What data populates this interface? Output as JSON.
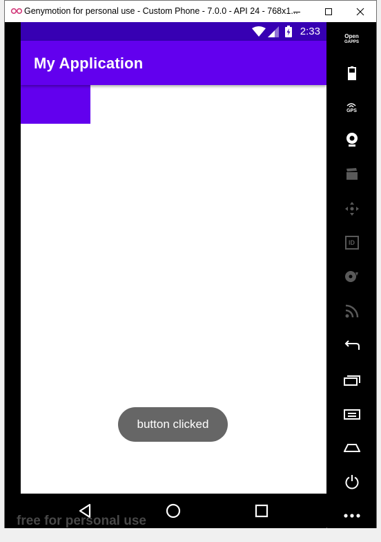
{
  "window": {
    "title": "Genymotion for personal use - Custom Phone - 7.0.0 - API 24 - 768x1...",
    "minimize_icon": "minimize-icon",
    "maximize_icon": "maximize-icon",
    "close_icon": "close-icon"
  },
  "statusbar": {
    "time": "2:33",
    "icons": [
      "wifi-icon",
      "signal-icon",
      "battery-charging-icon"
    ]
  },
  "app": {
    "title": "My Application",
    "toast": "button clicked",
    "colors": {
      "primary": "#6200ee",
      "primary_dark": "#3700b3",
      "toast": "#666666"
    }
  },
  "navbar": {
    "buttons": [
      "back-icon",
      "home-icon",
      "recents-icon"
    ]
  },
  "watermark": "free for personal use",
  "sidebar": {
    "opengapps_top": "Open",
    "opengapps_bottom": "GAPPS",
    "gps_label": "GPS",
    "id_label": "ID"
  }
}
